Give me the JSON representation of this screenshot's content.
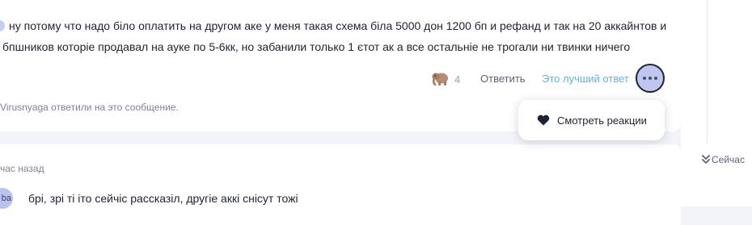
{
  "thread": {
    "message1": {
      "line1": "ну потому что надо біло оплатить на другом аке у меня такая схема біла 5000 дон 1200 бп и рефанд и так на 20 аккайнтов и",
      "line2": "бпшников которіе продавал на ауке по 5-6кк, но забанили только 1 єтот ак а все остальніе не трогали ни твинки ничего",
      "reaction": {
        "emoji": "mammoth-emoji",
        "count": "4"
      },
      "reply_label": "Ответить",
      "best_answer_label": "Это лучший ответ",
      "more_icon": "more-dots-icon",
      "replied_note": "Virusnyaga ответили на это сообщение."
    },
    "reactions_popup": {
      "icon": "heart-icon",
      "label": "Смотреть реакции"
    },
    "message2": {
      "time": "час назад",
      "avatar_initials": "ba",
      "text": "брі, зрі ті іто сейчіс рассказіл, другіе аккі снісут тожі"
    },
    "jump_now": {
      "icon": "double-chevron-down-icon",
      "label": "Сейчас"
    }
  },
  "colors": {
    "background": "#f3f4f9",
    "card": "#ffffff",
    "accent_link": "#5ab6de",
    "avatar": "#c7ccf2"
  }
}
